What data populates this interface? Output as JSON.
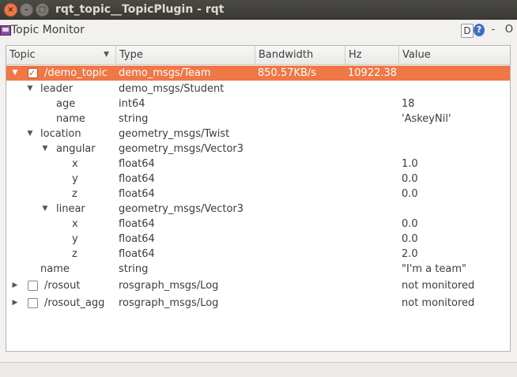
{
  "window": {
    "title": "rqt_topic__TopicPlugin - rqt",
    "close_glyph": "×",
    "minimize_glyph": "–",
    "maximize_glyph": "□"
  },
  "plugin": {
    "title": "Topic Monitor",
    "d_button": "D",
    "help_button": "?",
    "minimize_button": "-",
    "close_button": "O"
  },
  "columns": {
    "topic": "Topic",
    "type": "Type",
    "bandwidth": "Bandwidth",
    "hz": "Hz",
    "value": "Value"
  },
  "rows": [
    {
      "topic": "/demo_topic",
      "type": "demo_msgs/Team",
      "bandwidth": "850.57KB/s",
      "hz": "10922.38",
      "value": ""
    },
    {
      "topic": "leader",
      "type": "demo_msgs/Student",
      "bandwidth": "",
      "hz": "",
      "value": ""
    },
    {
      "topic": "age",
      "type": "int64",
      "bandwidth": "",
      "hz": "",
      "value": "18"
    },
    {
      "topic": "name",
      "type": "string",
      "bandwidth": "",
      "hz": "",
      "value": "'AskeyNil'"
    },
    {
      "topic": "location",
      "type": "geometry_msgs/Twist",
      "bandwidth": "",
      "hz": "",
      "value": ""
    },
    {
      "topic": "angular",
      "type": "geometry_msgs/Vector3",
      "bandwidth": "",
      "hz": "",
      "value": ""
    },
    {
      "topic": "x",
      "type": "float64",
      "bandwidth": "",
      "hz": "",
      "value": "1.0"
    },
    {
      "topic": "y",
      "type": "float64",
      "bandwidth": "",
      "hz": "",
      "value": "0.0"
    },
    {
      "topic": "z",
      "type": "float64",
      "bandwidth": "",
      "hz": "",
      "value": "0.0"
    },
    {
      "topic": "linear",
      "type": "geometry_msgs/Vector3",
      "bandwidth": "",
      "hz": "",
      "value": ""
    },
    {
      "topic": "x",
      "type": "float64",
      "bandwidth": "",
      "hz": "",
      "value": "0.0"
    },
    {
      "topic": "y",
      "type": "float64",
      "bandwidth": "",
      "hz": "",
      "value": "0.0"
    },
    {
      "topic": "z",
      "type": "float64",
      "bandwidth": "",
      "hz": "",
      "value": "2.0"
    },
    {
      "topic": "name",
      "type": "string",
      "bandwidth": "",
      "hz": "",
      "value": "\"I'm a team\""
    },
    {
      "topic": "/rosout",
      "type": "rosgraph_msgs/Log",
      "bandwidth": "",
      "hz": "",
      "value": "not monitored"
    },
    {
      "topic": "/rosout_agg",
      "type": "rosgraph_msgs/Log",
      "bandwidth": "",
      "hz": "",
      "value": "not monitored"
    }
  ],
  "colors": {
    "selection": "#f07746",
    "titlebar": "#3c3b37"
  }
}
